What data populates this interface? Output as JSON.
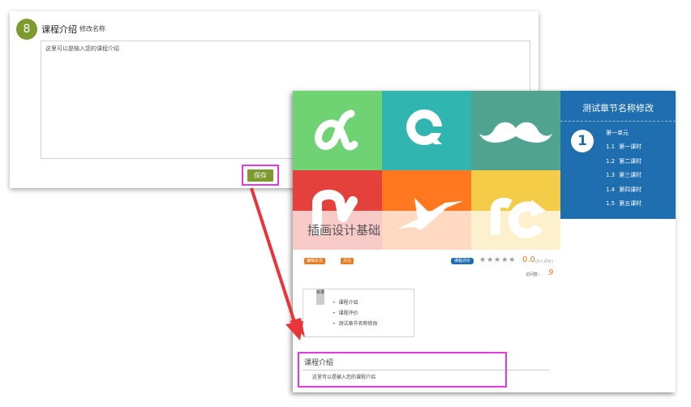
{
  "editor": {
    "step_number": "8",
    "section_title": "课程介绍",
    "rename_link": "修改名称",
    "textarea_placeholder": "这里可以是输入您的课程介绍",
    "save_label": "保存"
  },
  "preview": {
    "cover": {
      "title": "插画设计基础",
      "tile_colors": [
        "#6fd374",
        "#30b5b0",
        "#50a38f",
        "#e5413c",
        "#ff7820",
        "#f4cc48"
      ]
    },
    "chapter_sidebar": {
      "title": "测试章节名称修改",
      "chapter_number": "1",
      "unit_label": "第一单元",
      "lessons": [
        {
          "num": "1.1",
          "name": "第一课时"
        },
        {
          "num": "1.2",
          "name": "第二课时"
        },
        {
          "num": "1.3",
          "name": "第三课时"
        },
        {
          "num": "1.4",
          "name": "第四课时"
        },
        {
          "num": "1.5",
          "name": "第五课时"
        }
      ]
    },
    "info_bar": {
      "edit_tag": "编辑本页",
      "follow_tag": "关注",
      "rating_badge": "课程评价",
      "stars": "★★★★★",
      "score": "0.0",
      "rating_count": "(0人评价)",
      "visit_label": "访问数：",
      "visit_count": "9"
    },
    "toc": {
      "ribbon": "目录",
      "items": [
        "课程介绍",
        "课程评价",
        "测试章节名称修改"
      ]
    },
    "intro": {
      "heading": "课程介绍",
      "text": "这里可以是输入您的课程介绍"
    }
  },
  "colors": {
    "accent_green": "#7d9a2e",
    "highlight": "#e23be6",
    "sidebar_blue": "#1e6eb0",
    "orange": "#e87a1f",
    "arrow_red": "#e8353a"
  }
}
